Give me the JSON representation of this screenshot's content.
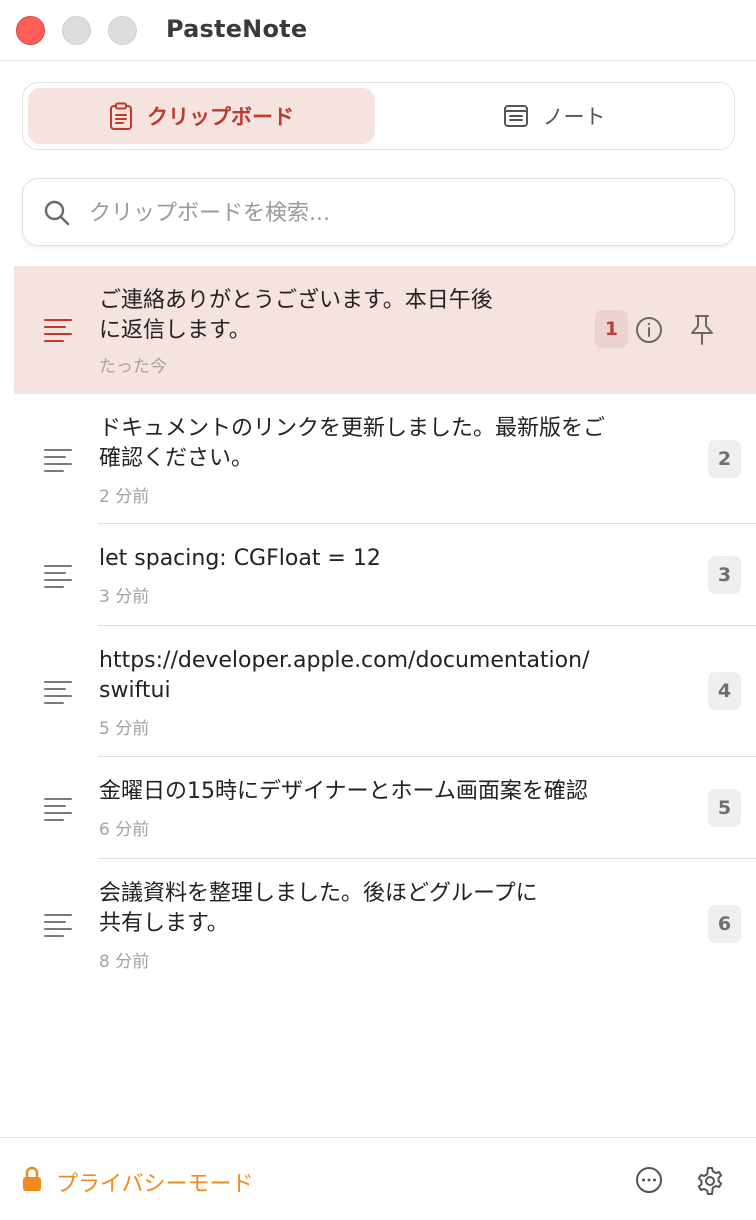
{
  "window": {
    "title": "PasteNote"
  },
  "tabs": [
    {
      "label": "クリップボード",
      "icon": "clipboard-icon",
      "active": true
    },
    {
      "label": "ノート",
      "icon": "note-icon",
      "active": false
    }
  ],
  "search": {
    "placeholder": "クリップボードを検索...",
    "value": ""
  },
  "clips": [
    {
      "line1": "ご連絡ありがとうございます。本日午後",
      "line2": "に返信します。",
      "time": "たった今",
      "index": "1",
      "selected": true
    },
    {
      "line1": "ドキュメントのリンクを更新しました。最新版をご",
      "line2": "確認ください。",
      "time": "2 分前",
      "index": "2",
      "selected": false
    },
    {
      "line1": "let spacing: CGFloat = 12",
      "line2": "",
      "time": "3 分前",
      "index": "3",
      "selected": false
    },
    {
      "line1": "https://developer.apple.com/documentation/",
      "line2": "swiftui",
      "time": "5 分前",
      "index": "4",
      "selected": false
    },
    {
      "line1": "金曜日の15時にデザイナーとホーム画面案を確認",
      "line2": "",
      "time": "6 分前",
      "index": "5",
      "selected": false
    },
    {
      "line1": "会議資料を整理しました。後ほどグループに",
      "line2": "共有します。",
      "time": "8 分前",
      "index": "6",
      "selected": false
    }
  ],
  "footer": {
    "privacy_label": "プライバシーモード"
  },
  "colors": {
    "accent": "#c0392b",
    "selected_bg": "#f5e3e0",
    "privacy": "#f08a1c",
    "close": "#ff5f57"
  }
}
